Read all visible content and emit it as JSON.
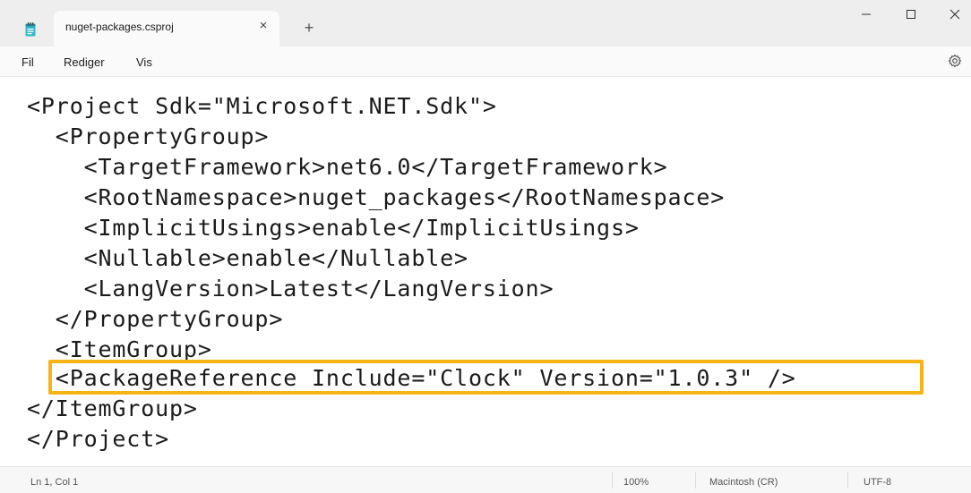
{
  "window": {
    "tab_title": "nuget-packages.csproj",
    "tab_icon": "notepad-icon",
    "close_tab_glyph": "×",
    "new_tab_glyph": "+",
    "minimize_glyph": "—",
    "maximize_glyph": "☐",
    "close_glyph": "✕"
  },
  "menu": {
    "items": [
      "Fil",
      "Rediger",
      "Vis"
    ],
    "settings_icon": "gear-icon"
  },
  "editor": {
    "lines": [
      "<Project Sdk=\"Microsoft.NET.Sdk\">",
      "  <PropertyGroup>",
      "    <TargetFramework>net6.0</TargetFramework>",
      "    <RootNamespace>nuget_packages</RootNamespace>",
      "    <ImplicitUsings>enable</ImplicitUsings>",
      "    <Nullable>enable</Nullable>",
      "    <LangVersion>Latest</LangVersion>",
      "  </PropertyGroup>",
      "  <ItemGroup>",
      "  <PackageReference Include=\"Clock\" Version=\"1.0.3\" />",
      "</ItemGroup>",
      "</Project>"
    ],
    "highlighted_line_index": 9,
    "highlight_color": "#f6b416"
  },
  "status": {
    "position": "Ln 1, Col 1",
    "zoom": "100%",
    "line_ending": "Macintosh (CR)",
    "encoding": "UTF-8"
  }
}
